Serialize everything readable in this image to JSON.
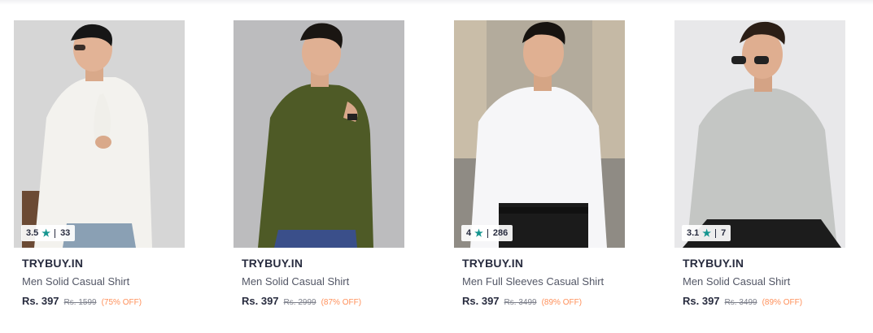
{
  "products": [
    {
      "brand": "TRYBUY.IN",
      "title": "Men Solid Casual Shirt",
      "price": "Rs. 397",
      "mrp": "Rs. 1599",
      "discount": "(75% OFF)",
      "rating": "3.5",
      "rating_count": "33",
      "shirt_color": "#f3f2ee",
      "bg_color": "#d9d9d9"
    },
    {
      "brand": "TRYBUY.IN",
      "title": "Men Solid Casual Shirt",
      "price": "Rs. 397",
      "mrp": "Rs. 2999",
      "discount": "(87% OFF)",
      "rating": "",
      "rating_count": "",
      "shirt_color": "#4e5a26",
      "bg_color": "#b9b9bb"
    },
    {
      "brand": "TRYBUY.IN",
      "title": "Men Full Sleeves Casual Shirt",
      "price": "Rs. 397",
      "mrp": "Rs. 3499",
      "discount": "(89% OFF)",
      "rating": "4",
      "rating_count": "286",
      "shirt_color": "#f6f6f8",
      "bg_color": "#b1a99b"
    },
    {
      "brand": "TRYBUY.IN",
      "title": "Men Solid Casual Shirt",
      "price": "Rs. 397",
      "mrp": "Rs. 3499",
      "discount": "(89% OFF)",
      "rating": "3.1",
      "rating_count": "7",
      "shirt_color": "#c4c6c4",
      "bg_color": "#e7e7e8"
    }
  ],
  "icons": {
    "rating_star": "star-icon"
  },
  "colors": {
    "star": "#14958f",
    "discount": "#ff905a",
    "text_dark": "#282c3f"
  }
}
